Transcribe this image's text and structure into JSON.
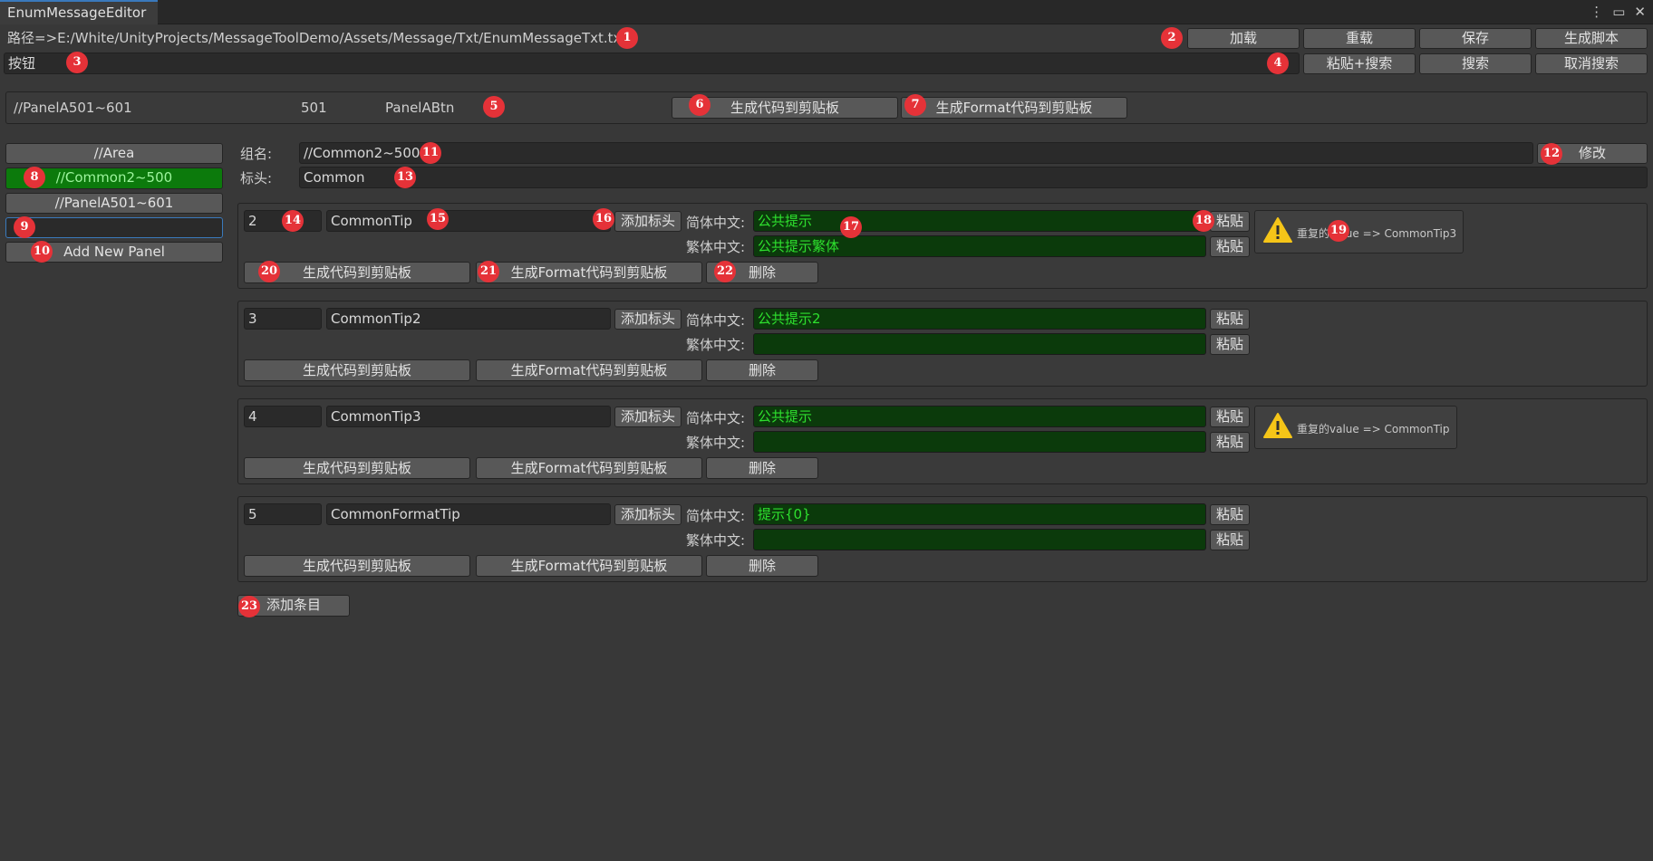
{
  "window": {
    "tab_title": "EnumMessageEditor",
    "icons": [
      "more-options-icon",
      "maximize-icon",
      "close-icon"
    ]
  },
  "toolbar": {
    "path_text": "路径=>E:/White/UnityProjects/MessageToolDemo/Assets/Message/Txt/EnumMessageTxt.txt",
    "load_label": "加载",
    "reload_label": "重载",
    "save_label": "保存",
    "gen_script_label": "生成脚本",
    "search_value": "按钮",
    "paste_search_label": "粘贴+搜索",
    "search_label": "搜索",
    "cancel_search_label": "取消搜索"
  },
  "search_result": {
    "group": "//PanelA501~601",
    "id": "501",
    "name": "PanelABtn",
    "gen_code_label": "生成代码到剪贴板",
    "gen_format_label": "生成Format代码到剪贴板"
  },
  "sidebar": {
    "items": [
      {
        "label": "//Area",
        "selected": false
      },
      {
        "label": "//Common2~500",
        "selected": true
      },
      {
        "label": "//PanelA501~601",
        "selected": false
      }
    ],
    "new_panel_value": "",
    "add_panel_label": "Add New Panel"
  },
  "group": {
    "name_label": "组名:",
    "name_value": "//Common2~500",
    "modify_label": "修改",
    "header_label": "标头:",
    "header_value": "Common"
  },
  "entry_labels": {
    "add_header": "添加标头",
    "simplified": "简体中文:",
    "traditional": "繁体中文:",
    "paste": "粘贴",
    "gen_code": "生成代码到剪贴板",
    "gen_format": "生成Format代码到剪贴板",
    "delete": "删除"
  },
  "entries": [
    {
      "id": "2",
      "key": "CommonTip",
      "simplified": "公共提示",
      "traditional": "公共提示繁体",
      "warning": "重复的value => CommonTip3"
    },
    {
      "id": "3",
      "key": "CommonTip2",
      "simplified": "公共提示2",
      "traditional": "",
      "warning": null
    },
    {
      "id": "4",
      "key": "CommonTip3",
      "simplified": "公共提示",
      "traditional": "",
      "warning": "重复的value => CommonTip"
    },
    {
      "id": "5",
      "key": "CommonFormatTip",
      "simplified": "提示{0}",
      "traditional": "",
      "warning": null
    }
  ],
  "add_entry_label": "添加条目",
  "annotations": [
    "1",
    "2",
    "3",
    "4",
    "5",
    "6",
    "7",
    "8",
    "9",
    "10",
    "11",
    "12",
    "13",
    "14",
    "15",
    "16",
    "17",
    "18",
    "19",
    "20",
    "21",
    "22",
    "23"
  ],
  "colors": {
    "background": "#383838",
    "selected_green": "#0c7a0c",
    "text_green": "#2ee02e",
    "badge_red": "#e53238",
    "warning_yellow": "#f5c518",
    "tab_accent": "#3a79bb"
  }
}
